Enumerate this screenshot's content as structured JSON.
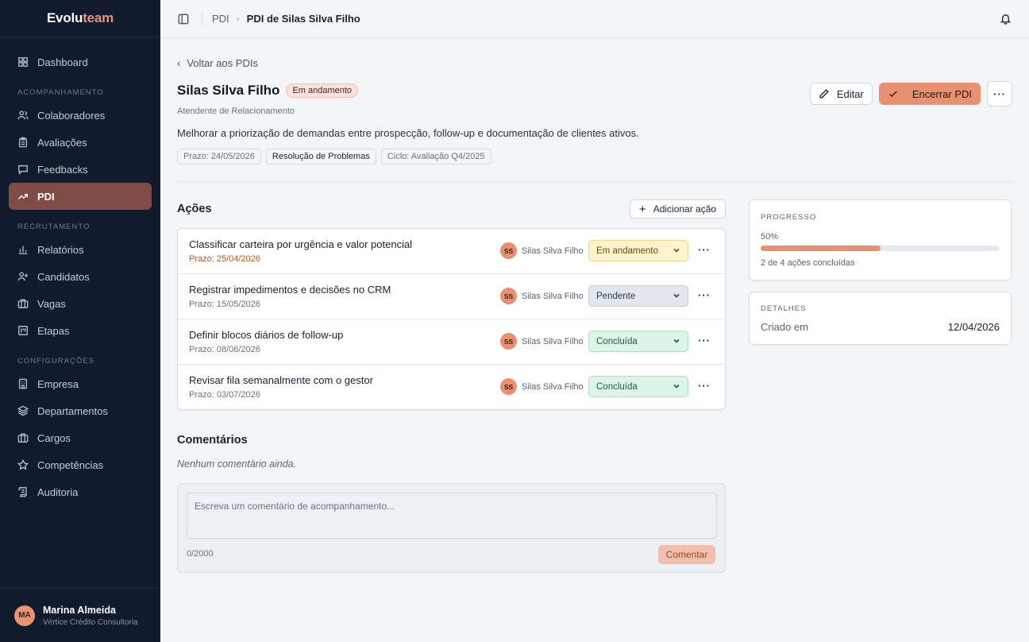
{
  "brand": {
    "name_a": "Evolu",
    "name_b": "team"
  },
  "sidebar": {
    "top_items": [
      {
        "label": "Dashboard",
        "icon": "grid-icon"
      }
    ],
    "sections": [
      {
        "label": "ACOMPANHAMENTO",
        "items": [
          {
            "label": "Colaboradores",
            "icon": "users-icon"
          },
          {
            "label": "Avaliações",
            "icon": "clipboard-icon"
          },
          {
            "label": "Feedbacks",
            "icon": "message-icon"
          },
          {
            "label": "PDI",
            "icon": "trending-up-icon",
            "active": true
          }
        ]
      },
      {
        "label": "RECRUTAMENTO",
        "items": [
          {
            "label": "Relatórios",
            "icon": "bar-chart-icon"
          },
          {
            "label": "Candidatos",
            "icon": "user-plus-icon"
          },
          {
            "label": "Vagas",
            "icon": "briefcase-icon"
          },
          {
            "label": "Etapas",
            "icon": "kanban-icon"
          }
        ]
      },
      {
        "label": "CONFIGURAÇÕES",
        "items": [
          {
            "label": "Empresa",
            "icon": "building-icon"
          },
          {
            "label": "Departamentos",
            "icon": "layers-icon"
          },
          {
            "label": "Cargos",
            "icon": "briefcase-icon"
          },
          {
            "label": "Competências",
            "icon": "star-icon"
          },
          {
            "label": "Auditoria",
            "icon": "scroll-icon"
          }
        ]
      }
    ],
    "user": {
      "initials": "MA",
      "name": "Marina Almeida",
      "company": "Vértice Crédito Consultoria"
    }
  },
  "topbar": {
    "breadcrumb_root": "PDI",
    "breadcrumb_current": "PDI de Silas Silva Filho"
  },
  "header": {
    "back_label": "Voltar aos PDIs",
    "title": "Silas Silva Filho",
    "status": "Em andamento",
    "role": "Atendente de Relacionamento",
    "description": "Melhorar a priorização de demandas entre prospecção, follow-up e documentação de clientes ativos.",
    "chips": [
      "Prazo: 24/05/2026",
      "Resolução de Problemas",
      "Ciclo: Avaliação Q4/2025"
    ],
    "edit_label": "Editar",
    "close_label": "Encerrar PDI",
    "more_label": "···"
  },
  "actions": {
    "title": "Ações",
    "add_label": "Adicionar ação",
    "items": [
      {
        "title": "Classificar carteira por urgência e valor potencial",
        "deadline": "Prazo: 25/04/2026",
        "late": true,
        "owner_initials": "SS",
        "owner": "Silas Silva Filho",
        "status": "Em andamento",
        "status_kind": "progress"
      },
      {
        "title": "Registrar impedimentos e decisões no CRM",
        "deadline": "Prazo: 15/05/2026",
        "late": false,
        "owner_initials": "SS",
        "owner": "Silas Silva Filho",
        "status": "Pendente",
        "status_kind": "pending"
      },
      {
        "title": "Definir blocos diários de follow-up",
        "deadline": "Prazo: 08/06/2026",
        "late": false,
        "owner_initials": "SS",
        "owner": "Silas Silva Filho",
        "status": "Concluída",
        "status_kind": "done"
      },
      {
        "title": "Revisar fila semanalmente com o gestor",
        "deadline": "Prazo: 03/07/2026",
        "late": false,
        "owner_initials": "SS",
        "owner": "Silas Silva Filho",
        "status": "Concluída",
        "status_kind": "done"
      }
    ]
  },
  "comments": {
    "title": "Comentários",
    "empty": "Nenhum comentário ainda.",
    "placeholder": "Escreva um comentário de acompanhamento...",
    "counter": "0/2000",
    "submit_label": "Comentar"
  },
  "progress": {
    "label": "PROGRESSO",
    "percent_text": "50%",
    "percent": 50,
    "summary": "2 de 4 ações concluídas"
  },
  "details": {
    "label": "DETALHES",
    "created_key": "Criado em",
    "created_value": "12/04/2026"
  }
}
